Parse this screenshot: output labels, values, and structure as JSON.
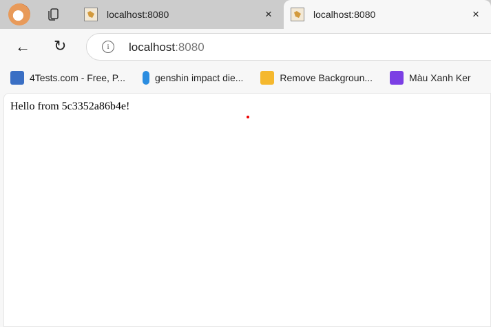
{
  "tabs": [
    {
      "title": "localhost:8080",
      "active": false
    },
    {
      "title": "localhost:8080",
      "active": true
    }
  ],
  "tab_close_glyph": "×",
  "address": {
    "host": "localhost",
    "port": ":8080"
  },
  "bookmarks": [
    {
      "label": "4Tests.com - Free, P...",
      "icon": "4tests-icon",
      "color": "#3a6fc4"
    },
    {
      "label": "genshin impact die...",
      "icon": "bing-icon",
      "color": "#2b8de0"
    },
    {
      "label": "Remove Backgroun...",
      "icon": "layers-icon",
      "color": "#f5b82e"
    },
    {
      "label": "Màu Xanh Ker",
      "icon": "canva-icon",
      "color": "#7b3fe4"
    }
  ],
  "page": {
    "text": "Hello from 5c3352a86b4e!"
  }
}
